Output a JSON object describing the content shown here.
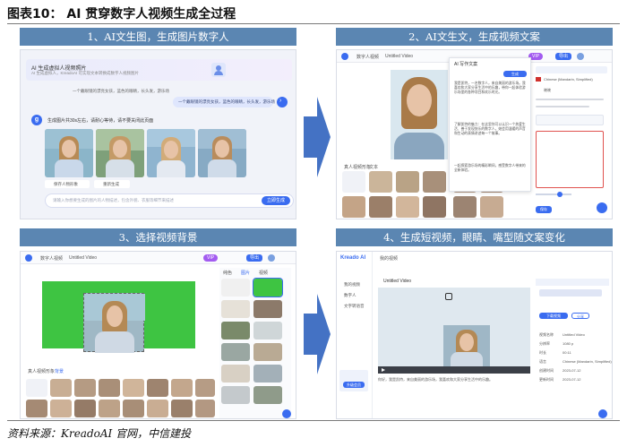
{
  "figure": {
    "title": "图表10：  AI 贯穿数字人视频生成全过程",
    "source": "资料来源：KreadoAI 官网，中信建投"
  },
  "panels": {
    "p1": {
      "heading": "1、AI文生图，生成图片数字人",
      "banner_title": "AI 生成虚拟人视频照片",
      "banner_sub": "AI 生成虚拟人，KreadoAI 可实现文本转换成数字人视频图片",
      "prompt_bubble": "一个戴眼镜的漂亮女孩，蓝色的眼睛，长头发，游乐场",
      "prompt_bubble2": "一个戴眼镜的漂亮女孩，蓝色的眼睛，长头发，游乐场",
      "result_text": "生成图片共30s左右，请耐心等待，请不要关闭此页面",
      "save_label": "保存人物形象",
      "regen_label": "重新生成",
      "input_placeholder": "请输入你想要生成的图片的人物描述，包含外貌、衣服等细节来描述",
      "generate_btn": "立即生成"
    },
    "p2": {
      "heading": "2、AI文生文，生成视频文案",
      "project_title": "数字人视频",
      "video_label": "Untitled Video",
      "tab_avatar": "真人视频形象",
      "tab_text": "文本",
      "script_title": "AI 写作文案",
      "script_para1": "我是凯特，一名数字人，来自美丽的游乐场。我喜欢和大家分享生活中的乐趣，带你一起体验游乐场里的各种项目和欢乐时光。",
      "script_para2": "了解凯特的魅力：在这里你可以认识一个热爱生活、善于发现快乐的数字人，她会用温暖的声音和生动的表情讲述每一个故事。",
      "script_para3": "一起探索游乐场的精彩瞬间，感受数字人带来的全新体验。",
      "language_label": "Chinese (Mandarin, Simplified)",
      "voice_label": "晓晓",
      "export_btn": "导出",
      "save_btn": "保存",
      "generate_btn": "生成"
    },
    "p3": {
      "heading": "3、选择视频背景",
      "project_title": "数字人视频",
      "video_label": "Untitled Video",
      "tab_avatar": "真人视频形象",
      "tab_bg": "背景",
      "bg_tabs": [
        "纯色",
        "图片",
        "视频"
      ],
      "export_btn": "导出"
    },
    "p4": {
      "heading": "4、生成短视频，眼睛、嘴型随文案变化",
      "logo": "Kreado AI",
      "video_label": "Untitled Video",
      "nav": [
        "我的视频",
        "数字人",
        "文字转语音"
      ],
      "script_excerpt": "你好，我是凯特，来自美丽的游乐场，我喜欢和大家分享生活中的乐趣。",
      "info_labels": [
        "视频名称",
        "分辨率",
        "时长",
        "语言",
        "创建时间",
        "更新时间"
      ],
      "info_values": [
        "Untitled Video",
        "1080 p",
        "00:11",
        "Chinese (Mandarin, Simplified)",
        "2023-07-12",
        "2023-07-12"
      ],
      "download_btn": "下载视频",
      "share_btn": "分享",
      "upgrade_btn": "升级会员"
    }
  },
  "colors": {
    "panel_head": "#5b86b2",
    "arrow": "#4472c4",
    "accent_blue": "#3a6cf0",
    "green_screen": "#3ec442",
    "red_highlight": "#e0524f",
    "purple_badge": "#a35cf0"
  }
}
